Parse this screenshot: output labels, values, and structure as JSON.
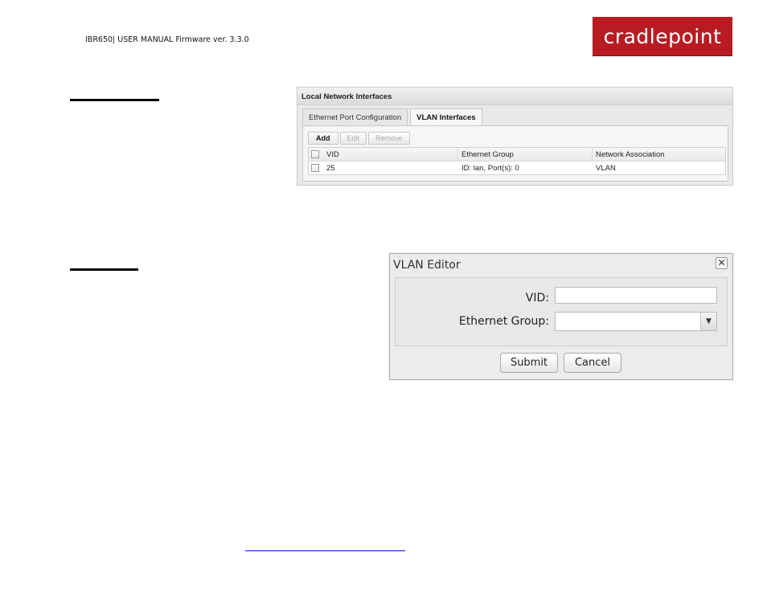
{
  "header": {
    "manual_text": "IBR650| USER MANUAL Firmware ver. 3.3.0",
    "logo_text": "cradlepoint",
    "brand_color": "#b81c22"
  },
  "local_network_interfaces": {
    "title": "Local Network Interfaces",
    "tabs": [
      {
        "label": "Ethernet Port Configuration",
        "active": false
      },
      {
        "label": "VLAN Interfaces",
        "active": true
      }
    ],
    "toolbar": {
      "add_label": "Add",
      "edit_label": "Edit",
      "remove_label": "Remove"
    },
    "table": {
      "columns": [
        "VID",
        "Ethernet Group",
        "Network Association"
      ],
      "rows": [
        {
          "vid": "25",
          "ethernet_group": "ID: lan, Port(s): 0",
          "network_association": "VLAN"
        }
      ]
    }
  },
  "vlan_editor": {
    "title": "VLAN Editor",
    "close_icon": "close-icon",
    "fields": {
      "vid_label": "VID:",
      "vid_value": "",
      "ethernet_group_label": "Ethernet Group:",
      "ethernet_group_value": ""
    },
    "submit_label": "Submit",
    "cancel_label": "Cancel"
  },
  "link_color": "#1212c8"
}
